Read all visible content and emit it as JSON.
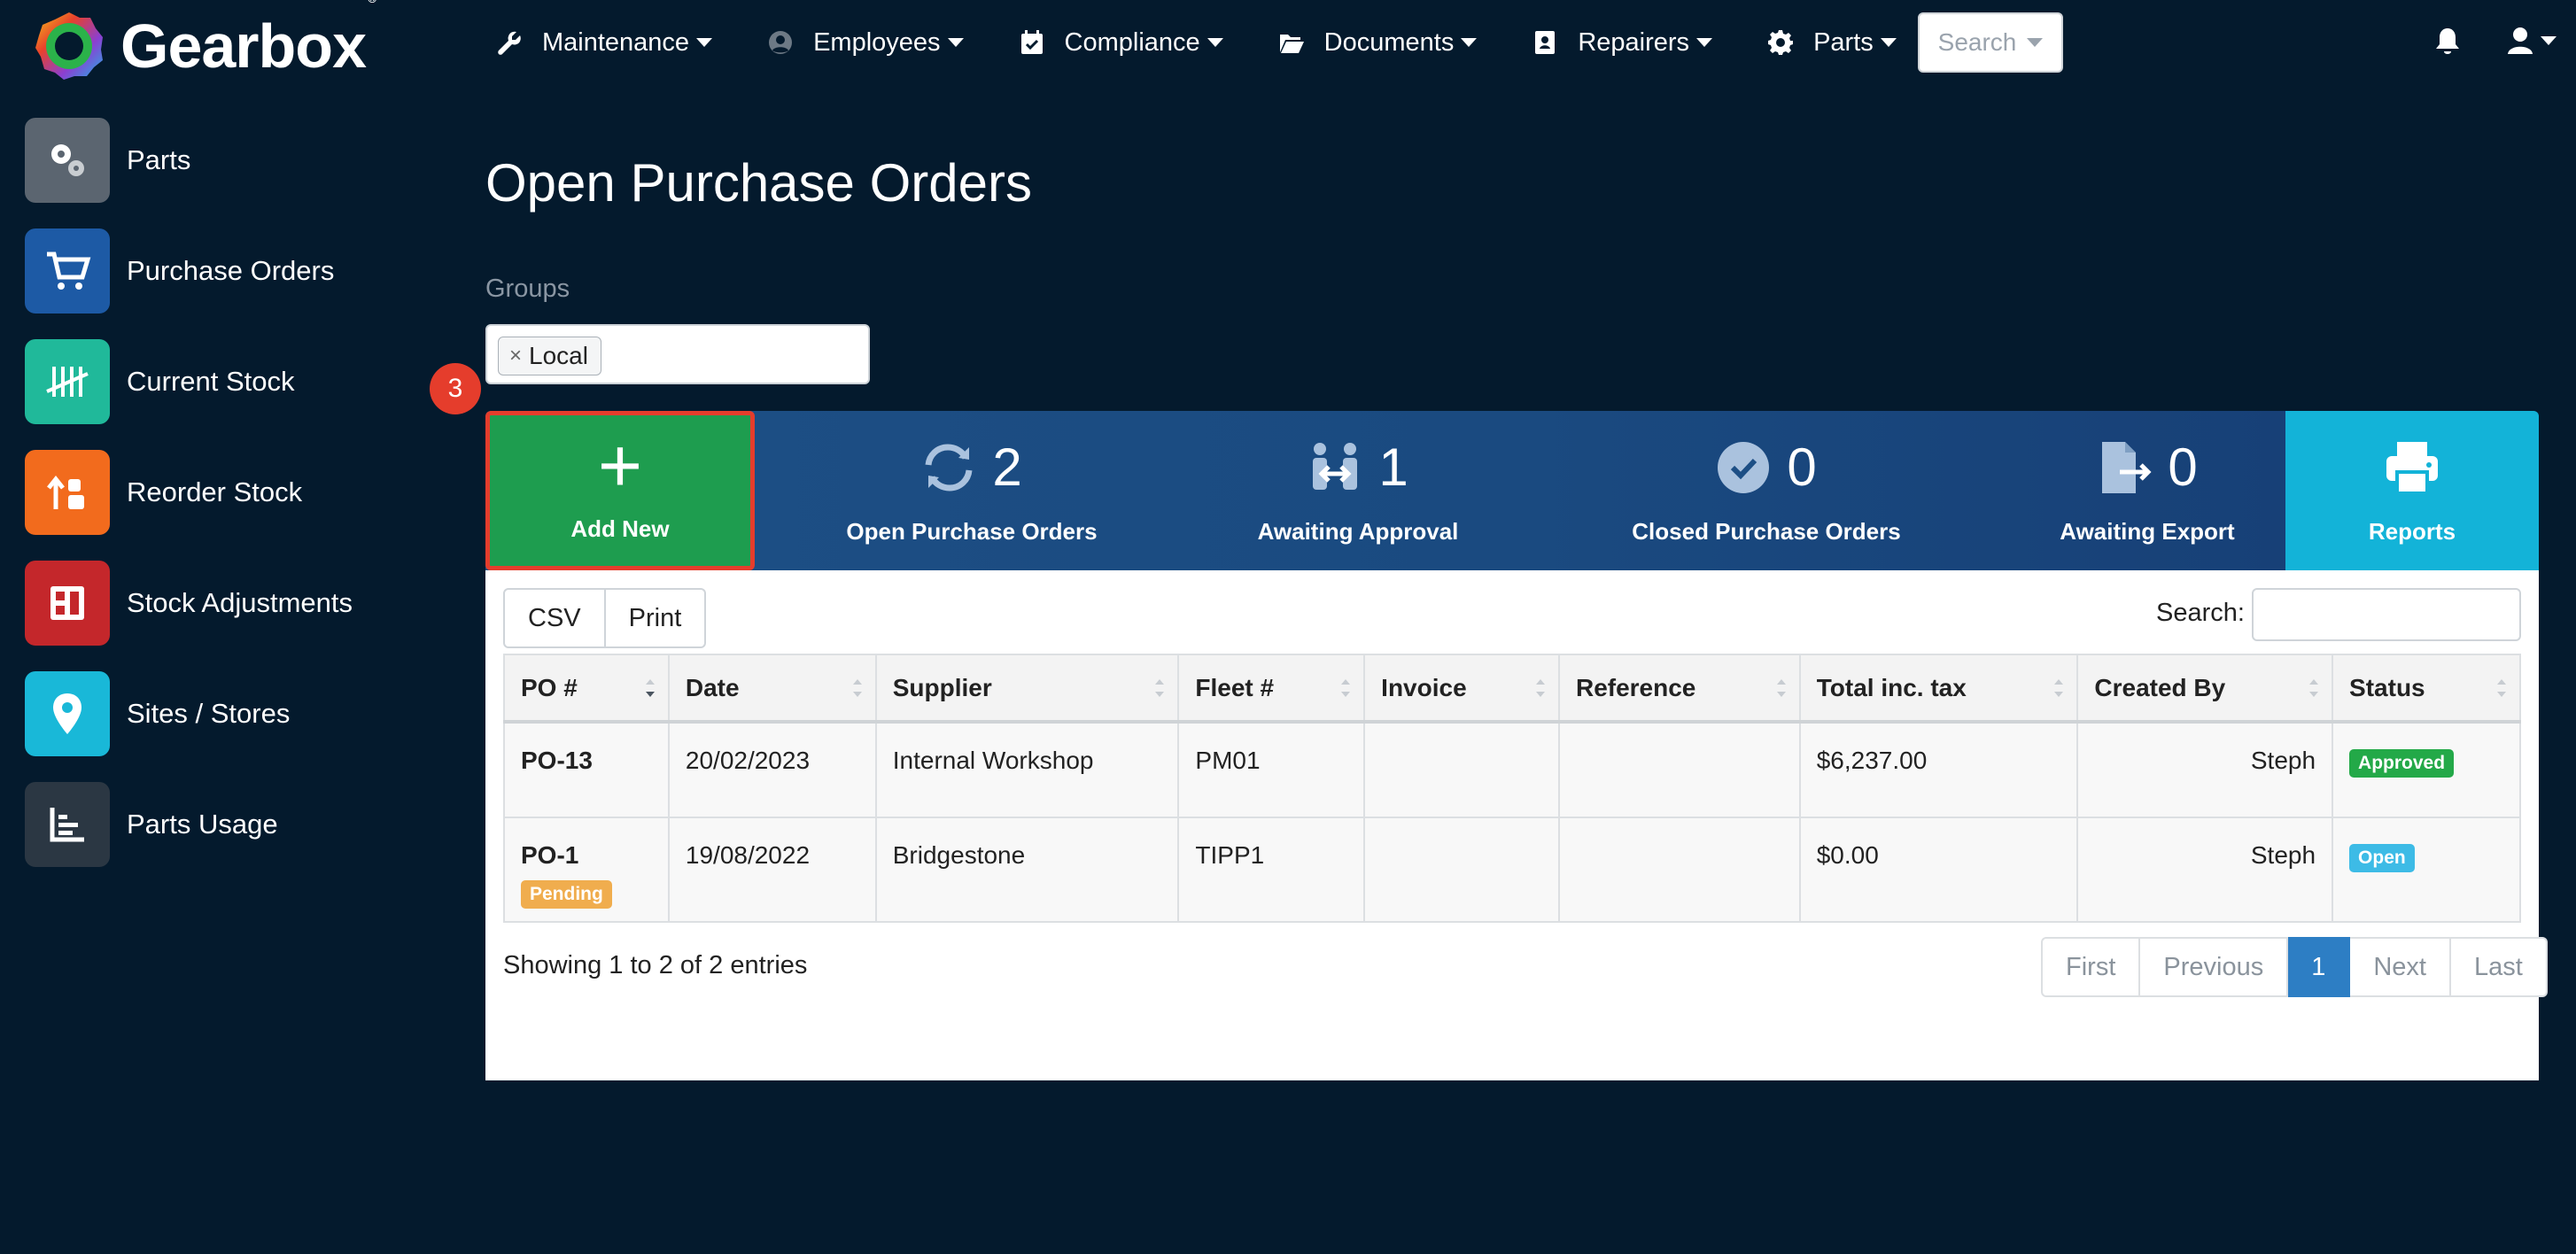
{
  "brand": {
    "name": "Gearbox",
    "reg": "®"
  },
  "nav": {
    "items": [
      {
        "label": "Maintenance",
        "icon": "wrench-icon"
      },
      {
        "label": "Employees",
        "icon": "user-circle-icon"
      },
      {
        "label": "Compliance",
        "icon": "calendar-check-icon"
      },
      {
        "label": "Documents",
        "icon": "folder-open-icon"
      },
      {
        "label": "Repairers",
        "icon": "contact-card-icon"
      },
      {
        "label": "Parts",
        "icon": "gear-icon"
      }
    ],
    "search_label": "Search"
  },
  "sidebar": {
    "items": [
      {
        "label": "Parts",
        "icon": "gears-icon",
        "color": "#5b6570"
      },
      {
        "label": "Purchase Orders",
        "icon": "cart-icon",
        "color": "#1d5aa5"
      },
      {
        "label": "Current Stock",
        "icon": "tally-icon",
        "color": "#20b99a"
      },
      {
        "label": "Reorder Stock",
        "icon": "reorder-icon",
        "color": "#f26b1d"
      },
      {
        "label": "Stock Adjustments",
        "icon": "adjust-icon",
        "color": "#c4272b"
      },
      {
        "label": "Sites / Stores",
        "icon": "map-pin-icon",
        "color": "#19b8d8"
      },
      {
        "label": "Parts Usage",
        "icon": "bar-chart-icon",
        "color": "#2b3743"
      }
    ]
  },
  "main": {
    "title": "Open Purchase Orders",
    "groups_label": "Groups",
    "group_tag": "Local",
    "group_tag_remove": "×",
    "step_badge": "3"
  },
  "stats": {
    "add_new": {
      "plus": "+",
      "label": "Add New"
    },
    "open_po": {
      "count": "2",
      "label": "Open Purchase Orders"
    },
    "awaiting_approval": {
      "count": "1",
      "label": "Awaiting Approval"
    },
    "closed_po": {
      "count": "0",
      "label": "Closed Purchase Orders"
    },
    "awaiting_export": {
      "count": "0",
      "label": "Awaiting Export"
    },
    "reports": {
      "label": "Reports"
    }
  },
  "table": {
    "buttons": {
      "csv": "CSV",
      "print": "Print"
    },
    "search_label": "Search:",
    "columns": [
      "PO #",
      "Date",
      "Supplier",
      "Fleet #",
      "Invoice",
      "Reference",
      "Total inc. tax",
      "Created By",
      "Status"
    ],
    "rows": [
      {
        "po": "PO-13",
        "po_badge": "",
        "date": "20/02/2023",
        "supplier": "Internal Workshop",
        "fleet": "PM01",
        "invoice": "",
        "reference": "",
        "total": "$6,237.00",
        "created_by": "Steph",
        "status": "Approved"
      },
      {
        "po": "PO-1",
        "po_badge": "Pending",
        "date": "19/08/2022",
        "supplier": "Bridgestone",
        "fleet": "TIPP1",
        "invoice": "",
        "reference": "",
        "total": "$0.00",
        "created_by": "Steph",
        "status": "Open"
      }
    ],
    "showing": "Showing 1 to 2 of 2 entries",
    "pager": {
      "first": "First",
      "previous": "Previous",
      "current": "1",
      "next": "Next",
      "last": "Last"
    }
  }
}
